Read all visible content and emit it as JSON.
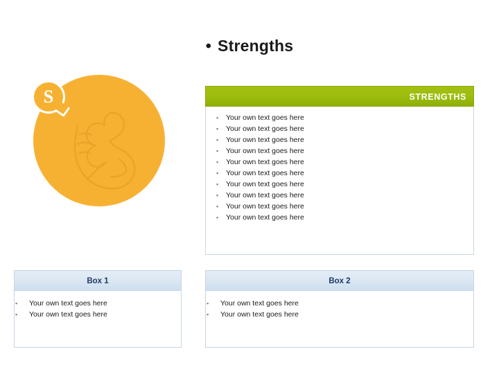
{
  "slide": {
    "title": "Strengths",
    "title_bullet": "•"
  },
  "graphic": {
    "letter": "S",
    "icon_name": "flexed-arm-muscle-icon",
    "circle_color": "#f7b132",
    "badge_border_color": "#ffffff"
  },
  "strengths_panel": {
    "header_label": "STRENGTHS",
    "header_color": "#9dbd0e",
    "bullet_glyph": "▪",
    "items": [
      "Your own text goes here",
      "Your own text goes here",
      "Your own text goes here",
      "Your own text goes here",
      "Your own text goes here",
      "Your own text goes here",
      "Your own text goes here",
      "Your own text goes here",
      "Your own text goes here",
      "Your own text goes here"
    ]
  },
  "box1": {
    "header_label": "Box 1",
    "bullet_glyph": "▪",
    "items": [
      "Your own text goes here",
      "Your own text goes here"
    ]
  },
  "box2": {
    "header_label": "Box 2",
    "bullet_glyph": "▪",
    "items": [
      "Your own text goes here",
      "Your own text goes here"
    ]
  }
}
